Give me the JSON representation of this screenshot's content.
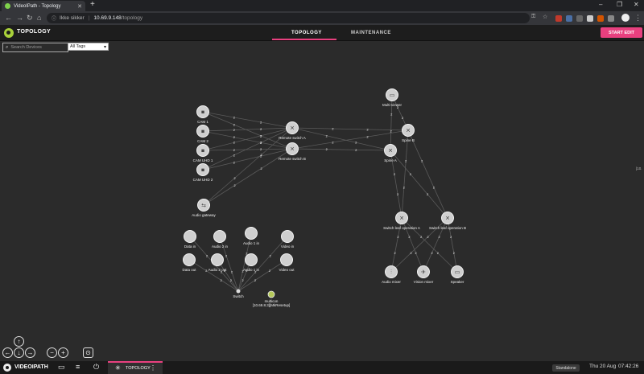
{
  "browser": {
    "tab_title": "VideoIPath - Topology",
    "new_tab": "+",
    "security_label": "Ikke sikker",
    "url_host": "10.69.9.148",
    "url_path": "/topology",
    "window_controls": [
      "–",
      "❐",
      "✕"
    ]
  },
  "header": {
    "app_title": "TOPOLOGY",
    "tabs": [
      {
        "label": "TOPOLOGY",
        "active": true
      },
      {
        "label": "MAINTENANCE",
        "active": false
      }
    ],
    "start_edit": "START EDIT",
    "accent_color": "#e8407f"
  },
  "filters": {
    "search_placeholder": "Search Devices",
    "tags_selected": "All Tags"
  },
  "topology": {
    "nodes": [
      {
        "id": "cam1",
        "label": "CAM 1",
        "icon": "camera-icon"
      },
      {
        "id": "cam2",
        "label": "CAM 2",
        "icon": "camera-icon"
      },
      {
        "id": "camuhd1",
        "label": "CAM UHD 1",
        "icon": "camera-icon"
      },
      {
        "id": "camuhd2",
        "label": "CAM UHD 2",
        "icon": "camera-icon"
      },
      {
        "id": "audiogw",
        "label": "Audio gateway",
        "icon": "gateway-icon"
      },
      {
        "id": "remoteA",
        "label": "Remote switch A",
        "icon": "switch-icon"
      },
      {
        "id": "remoteB",
        "label": "Remote switch B",
        "icon": "switch-icon"
      },
      {
        "id": "multiviewer",
        "label": "Multi-viewer",
        "icon": "monitor-icon"
      },
      {
        "id": "spineB",
        "label": "Spine B",
        "icon": "switch-icon"
      },
      {
        "id": "spineA",
        "label": "Spine A",
        "icon": "switch-icon"
      },
      {
        "id": "leafA",
        "label": "Switch leaf operation A",
        "icon": "switch-icon"
      },
      {
        "id": "leafB",
        "label": "Switch leaf operation B",
        "icon": "switch-icon"
      },
      {
        "id": "audiomixer",
        "label": "Audio mixer",
        "icon": "mixer-icon"
      },
      {
        "id": "visionmixer",
        "label": "Vision mixer",
        "icon": "vision-mixer-icon"
      },
      {
        "id": "speaker",
        "label": "Speaker",
        "icon": "monitor-icon"
      },
      {
        "id": "datain",
        "label": "Data in",
        "icon": "device-icon"
      },
      {
        "id": "audio2in",
        "label": "Audio 2 in",
        "icon": "device-icon"
      },
      {
        "id": "audio1in",
        "label": "Audio 1 in",
        "icon": "device-icon"
      },
      {
        "id": "videoin",
        "label": "Video in",
        "icon": "device-icon"
      },
      {
        "id": "dataout",
        "label": "Data out",
        "icon": "device-icon"
      },
      {
        "id": "audio2out",
        "label": "Audio 2 out",
        "icon": "device-icon"
      },
      {
        "id": "audio1in_b",
        "label": "Audio 1 in",
        "icon": "device-icon"
      },
      {
        "id": "videoout",
        "label": "Video out",
        "icon": "device-icon"
      },
      {
        "id": "switch",
        "label": "Switch",
        "icon": "dot-icon"
      },
      {
        "id": "multicon",
        "label": "multicon",
        "sublabel": "[10.69.8.3][MkResetup]",
        "icon": "green-dot-icon"
      }
    ],
    "edge_label": "2",
    "offscreen_label": "[10."
  },
  "controls": {
    "up": "↑",
    "left": "←",
    "down": "↓",
    "right": "→",
    "zoom_out": "−",
    "zoom_in": "+",
    "fit": "⊙"
  },
  "bottombar": {
    "brand": "VIDEOIPATH",
    "tab_label": "TOPOLOGY",
    "tab_menu": "⋮",
    "mode": "Standalone",
    "date": "Thu 20 Aug",
    "time": "07:42:26"
  }
}
